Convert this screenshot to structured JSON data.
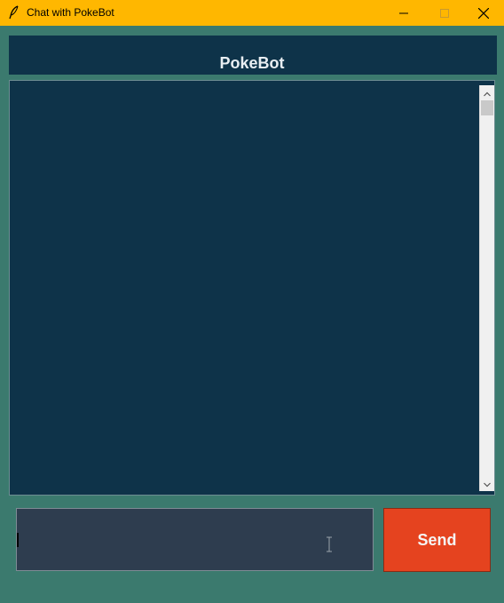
{
  "window": {
    "title": "Chat with PokeBot",
    "icon": "feather-icon",
    "controls": [
      "minimize-icon",
      "maximize-icon",
      "close-icon"
    ],
    "titlebar_color": "#ffb700"
  },
  "header": {
    "title": "PokeBot",
    "background": "#0e3349"
  },
  "chat": {
    "messages": [],
    "background": "#0e3349"
  },
  "composer": {
    "input_value": "",
    "send_label": "Send",
    "send_color": "#e5431f"
  },
  "colors": {
    "window_background": "#3b7a6e",
    "input_background": "#2e3d4f"
  }
}
